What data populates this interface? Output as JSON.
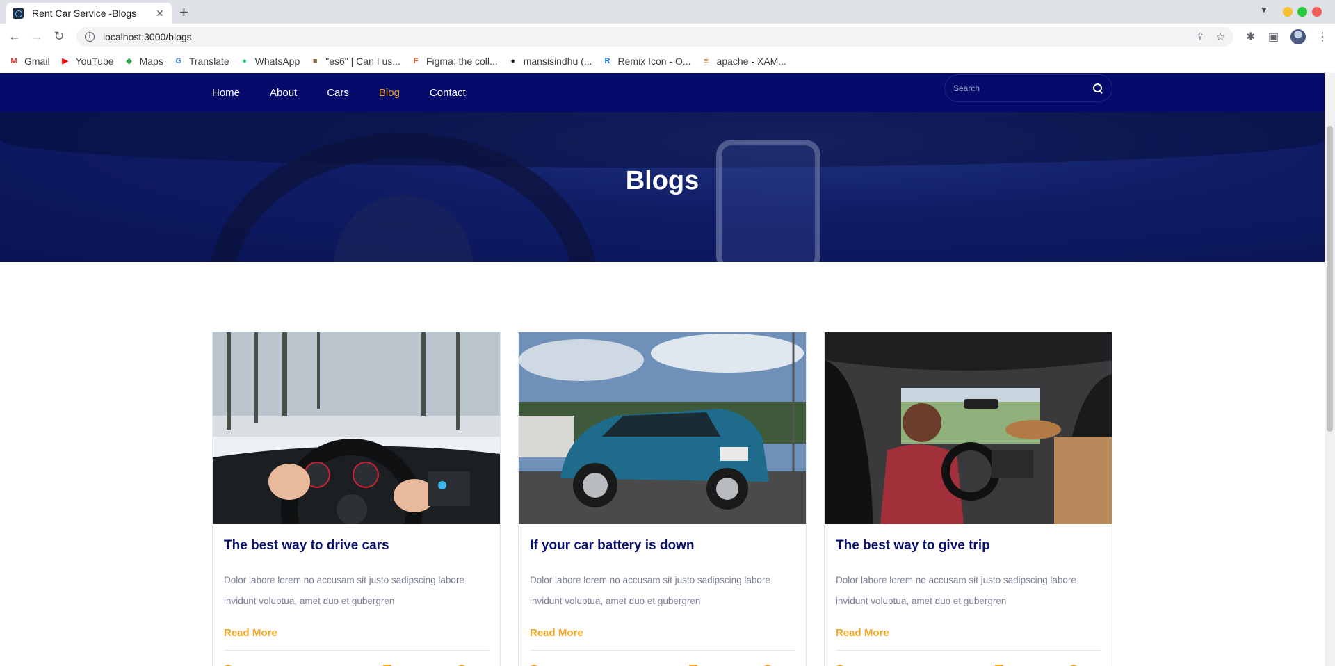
{
  "browser": {
    "tab_title": "Rent Car Service -Blogs",
    "tab_close": "✕",
    "new_tab": "+",
    "url": "localhost:3000/blogs",
    "bookmarks": [
      {
        "label": "Gmail",
        "icon": "gmail-icon",
        "glyph": "M",
        "color": "#d93025"
      },
      {
        "label": "YouTube",
        "icon": "youtube-icon",
        "glyph": "▶",
        "color": "#ff0000"
      },
      {
        "label": "Maps",
        "icon": "maps-icon",
        "glyph": "◆",
        "color": "#34a853"
      },
      {
        "label": "Translate",
        "icon": "translate-icon",
        "glyph": "G",
        "color": "#4285f4"
      },
      {
        "label": "WhatsApp",
        "icon": "whatsapp-icon",
        "glyph": "●",
        "color": "#25d366"
      },
      {
        "label": "\"es6\" | Can I us...",
        "icon": "caniuse-icon",
        "glyph": "■",
        "color": "#8a6d3b"
      },
      {
        "label": "Figma: the coll...",
        "icon": "figma-icon",
        "glyph": "F",
        "color": "#f24e1e"
      },
      {
        "label": "mansisindhu (...",
        "icon": "github-icon",
        "glyph": "●",
        "color": "#24292e"
      },
      {
        "label": "Remix Icon - O...",
        "icon": "remix-icon",
        "glyph": "R",
        "color": "#1a73e8"
      },
      {
        "label": "apache - XAM...",
        "icon": "stackoverflow-icon",
        "glyph": "≡",
        "color": "#f48024"
      }
    ]
  },
  "nav": {
    "links": [
      "Home",
      "About",
      "Cars",
      "Blog",
      "Contact"
    ],
    "active": "Blog",
    "search_placeholder": "Search"
  },
  "hero": {
    "title": "Blogs"
  },
  "blogs": [
    {
      "title": "The best way to drive cars",
      "excerpt": "Dolor labore lorem no accusam sit justo sadipscing labore invidunt voluptua, amet duo et gubergren",
      "link": "Read More"
    },
    {
      "title": "If your car battery is down",
      "excerpt": "Dolor labore lorem no accusam sit justo sadipscing labore invidunt voluptua, amet duo et gubergren",
      "link": "Read More"
    },
    {
      "title": "The best way to give trip",
      "excerpt": "Dolor labore lorem no accusam sit justo sadipscing labore invidunt voluptua, amet duo et gubergren",
      "link": "Read More"
    }
  ],
  "colors": {
    "navbar": "#050a6b",
    "accent": "#f5a623",
    "title": "#0a0f72"
  }
}
